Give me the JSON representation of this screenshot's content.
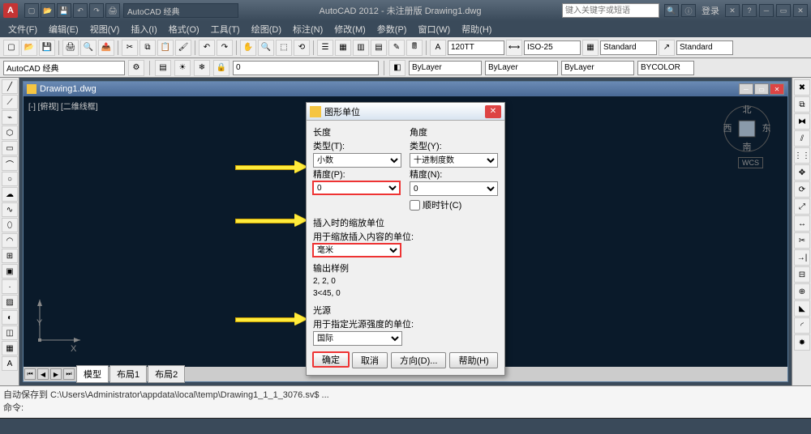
{
  "app": {
    "icon_letter": "A",
    "title": "AutoCAD 2012 - 未注册版   Drawing1.dwg"
  },
  "qat": {
    "workspace": "AutoCAD 经典"
  },
  "search": {
    "placeholder": "键入关键字或短语"
  },
  "login": {
    "label": "登录"
  },
  "menu": [
    "文件(F)",
    "编辑(E)",
    "视图(V)",
    "插入(I)",
    "格式(O)",
    "工具(T)",
    "绘图(D)",
    "标注(N)",
    "修改(M)",
    "参数(P)",
    "窗口(W)",
    "帮助(H)"
  ],
  "ribbon": {
    "textstyle_combo": "120TT",
    "dimstyle_combo": "ISO-25",
    "tablestyle_combo": "Standard",
    "mlstyle_combo": "Standard"
  },
  "props": {
    "workspace": "AutoCAD 经典",
    "layer_color": "ByLayer",
    "layer_ltype": "ByLayer",
    "layer_lweight": "ByLayer",
    "plot_style": "BYCOLOR"
  },
  "doc": {
    "title": "Drawing1.dwg",
    "viewport_label": "[-] [俯视] [二维线框]",
    "ucs_x": "X",
    "ucs_y": "Y",
    "wcs": "WCS",
    "cube": {
      "n": "北",
      "s": "南",
      "e": "东",
      "w": "西"
    },
    "tabs": [
      "模型",
      "布局1",
      "布局2"
    ]
  },
  "cmd": {
    "line1": "自动保存到 C:\\Users\\Administrator\\appdata\\local\\temp\\Drawing1_1_1_3076.sv$ ...",
    "line2": "命令:"
  },
  "dialog": {
    "title": "图形单位",
    "length_group": "长度",
    "length_type_label": "类型(T):",
    "length_type": "小数",
    "length_prec_label": "精度(P):",
    "length_prec": "0",
    "angle_group": "角度",
    "angle_type_label": "类型(Y):",
    "angle_type": "十进制度数",
    "angle_prec_label": "精度(N):",
    "angle_prec": "0",
    "clockwise": "顺时针(C)",
    "insert_group": "插入时的缩放单位",
    "insert_label": "用于缩放插入内容的单位:",
    "insert_unit": "毫米",
    "sample_group": "输出样例",
    "sample1": "2, 2, 0",
    "sample2": "3<45, 0",
    "light_group": "光源",
    "light_label": "用于指定光源强度的单位:",
    "light_unit": "国际",
    "ok": "确定",
    "cancel": "取消",
    "direction": "方向(D)...",
    "help": "帮助(H)"
  }
}
